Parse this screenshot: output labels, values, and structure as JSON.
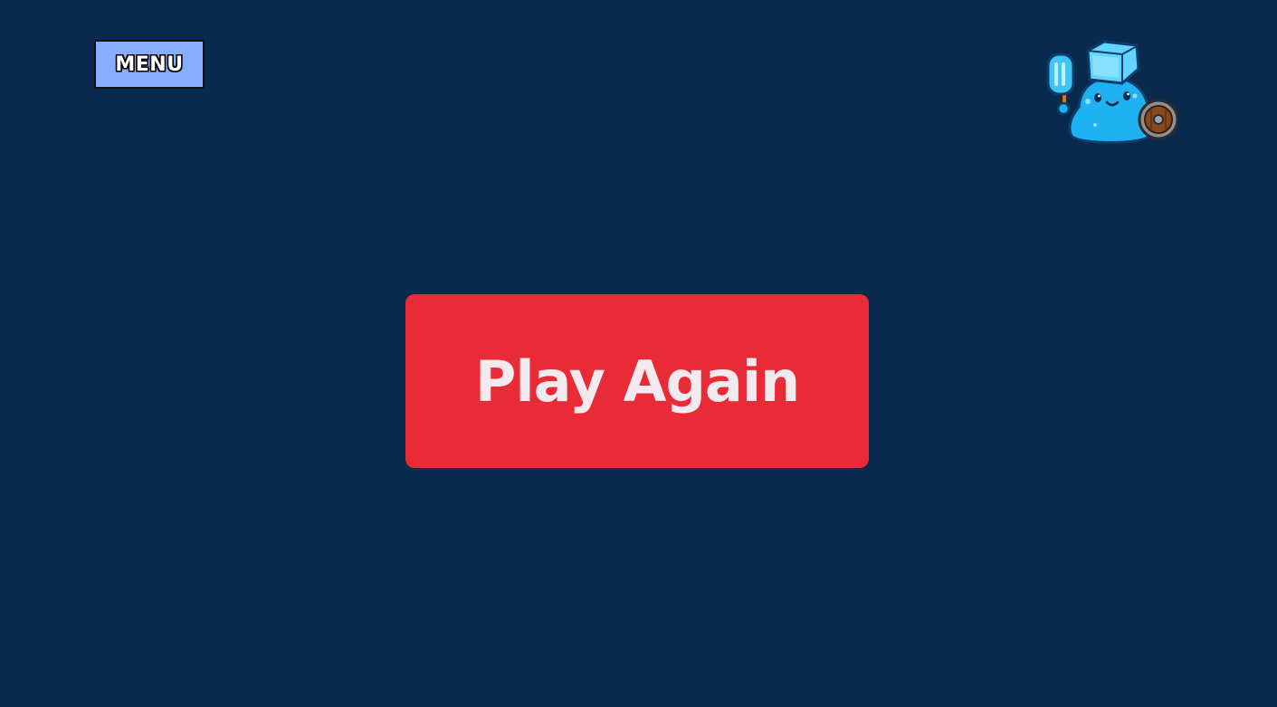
{
  "menu": {
    "label": "MENU"
  },
  "mascot": {
    "icon": "ice-slime-mascot-icon"
  },
  "play_again": {
    "label": "Play Again"
  },
  "colors": {
    "background": "#0a2a4d",
    "menu_button": "#86aeff",
    "play_again_button": "#e92a37",
    "play_again_text": "#f3eaf0"
  }
}
